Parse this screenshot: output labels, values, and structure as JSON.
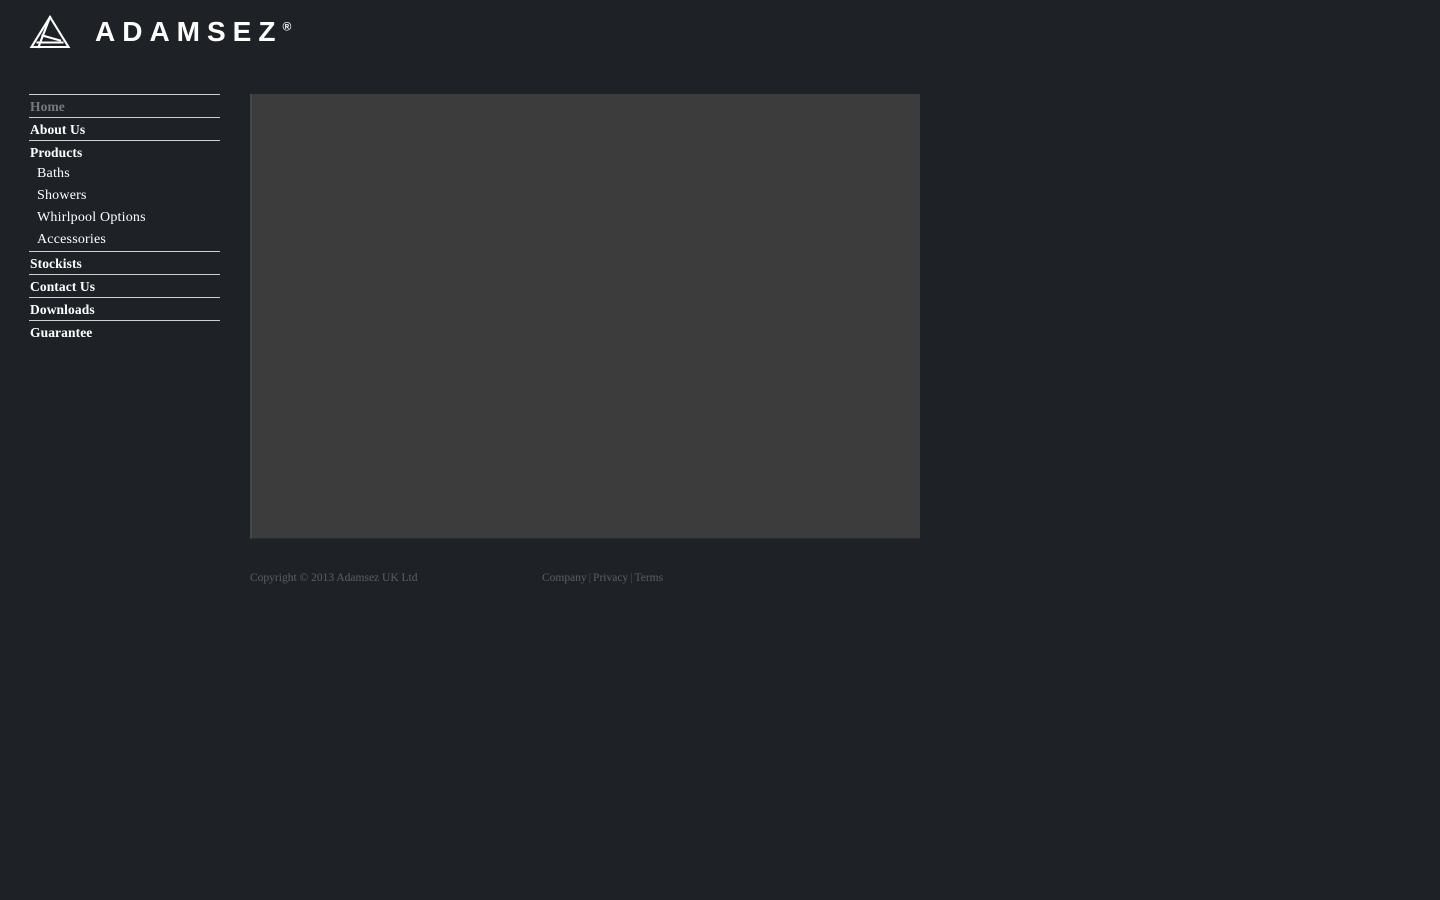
{
  "page": {
    "background_color": "#1e2227",
    "panel_color": "#3c3c3c",
    "rule_color": "#cfcfcf",
    "muted_text_color": "#76797d",
    "footer_text_color": "#5b5f64"
  },
  "header": {
    "logo_icon": "adamsez-triangle-logo-icon",
    "wordmark": "ADAMSEZ",
    "trademark": "®"
  },
  "sidebar": {
    "items": [
      {
        "label": "Home",
        "state": "current",
        "rule_above": true,
        "level": 1
      },
      {
        "label": "About Us",
        "state": "default",
        "rule_above": true,
        "level": 1
      },
      {
        "label": "Products",
        "state": "default",
        "rule_above": true,
        "level": 1
      },
      {
        "label": "Baths",
        "state": "default",
        "rule_above": false,
        "level": 2
      },
      {
        "label": "Showers",
        "state": "default",
        "rule_above": false,
        "level": 2
      },
      {
        "label": "Whirlpool Options",
        "state": "default",
        "rule_above": false,
        "level": 2
      },
      {
        "label": "Accessories",
        "state": "default",
        "rule_above": false,
        "level": 2
      },
      {
        "label": "Stockists",
        "state": "default",
        "rule_above": true,
        "level": 1
      },
      {
        "label": "Contact Us",
        "state": "default",
        "rule_above": true,
        "level": 1
      },
      {
        "label": "Downloads",
        "state": "default",
        "rule_above": true,
        "level": 1
      },
      {
        "label": "Guarantee",
        "state": "default",
        "rule_above": true,
        "level": 1
      }
    ]
  },
  "main": {
    "panel_placeholder": ""
  },
  "footer": {
    "copyright": "Copyright © 2013 Adamsez UK Ltd",
    "links": [
      {
        "label": "Company"
      },
      {
        "label": "Privacy"
      },
      {
        "label": "Terms"
      }
    ],
    "separator": "|"
  }
}
